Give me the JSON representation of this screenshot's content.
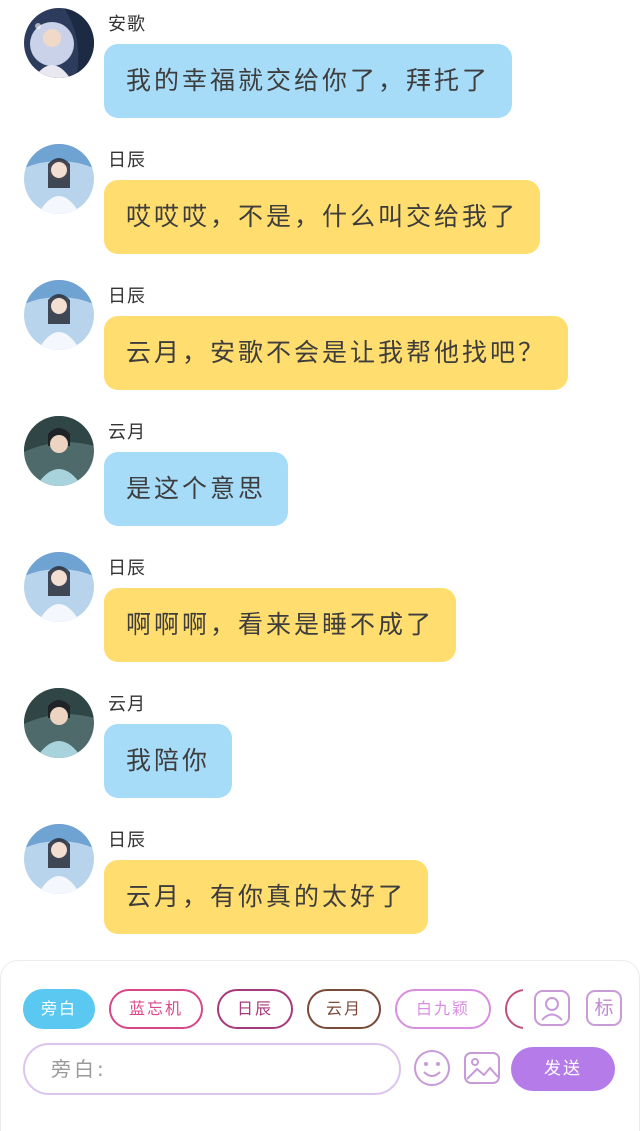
{
  "messages": [
    {
      "sender": "安歌",
      "text": "我的幸福就交给你了，拜托了",
      "color": "blue",
      "avatar": "an-ge-avatar"
    },
    {
      "sender": "日辰",
      "text": "哎哎哎，不是，什么叫交给我了",
      "color": "yellow",
      "avatar": "ri-chen-avatar"
    },
    {
      "sender": "日辰",
      "text": "云月，安歌不会是让我帮他找吧？",
      "color": "yellow",
      "avatar": "ri-chen-avatar"
    },
    {
      "sender": "云月",
      "text": "是这个意思",
      "color": "blue",
      "avatar": "yun-yue-avatar"
    },
    {
      "sender": "日辰",
      "text": "啊啊啊，看来是睡不成了",
      "color": "yellow",
      "avatar": "ri-chen-avatar"
    },
    {
      "sender": "云月",
      "text": "我陪你",
      "color": "blue",
      "avatar": "yun-yue-avatar"
    },
    {
      "sender": "日辰",
      "text": "云月，有你真的太好了",
      "color": "yellow",
      "avatar": "ri-chen-avatar"
    }
  ],
  "panel": {
    "chips": [
      {
        "label": "旁白",
        "active": true,
        "color": "#5ac8f0"
      },
      {
        "label": "蓝忘机",
        "active": false,
        "color": "#d9478a"
      },
      {
        "label": "日辰",
        "active": false,
        "color": "#a63a7c"
      },
      {
        "label": "云月",
        "active": false,
        "color": "#7a4a3a"
      },
      {
        "label": "白九颖",
        "active": false,
        "color": "#d88ee0"
      }
    ],
    "add_character_icon": "person-card-icon",
    "mark_label": "标",
    "input_placeholder": "旁白:",
    "emoji_icon": "smiley-icon",
    "image_icon": "image-icon",
    "send_label": "发送",
    "colors": {
      "blue_bubble": "#a7dcf9",
      "yellow_bubble": "#ffdd6e",
      "send": "#b57be8",
      "input_border": "#dcc4ee"
    }
  }
}
